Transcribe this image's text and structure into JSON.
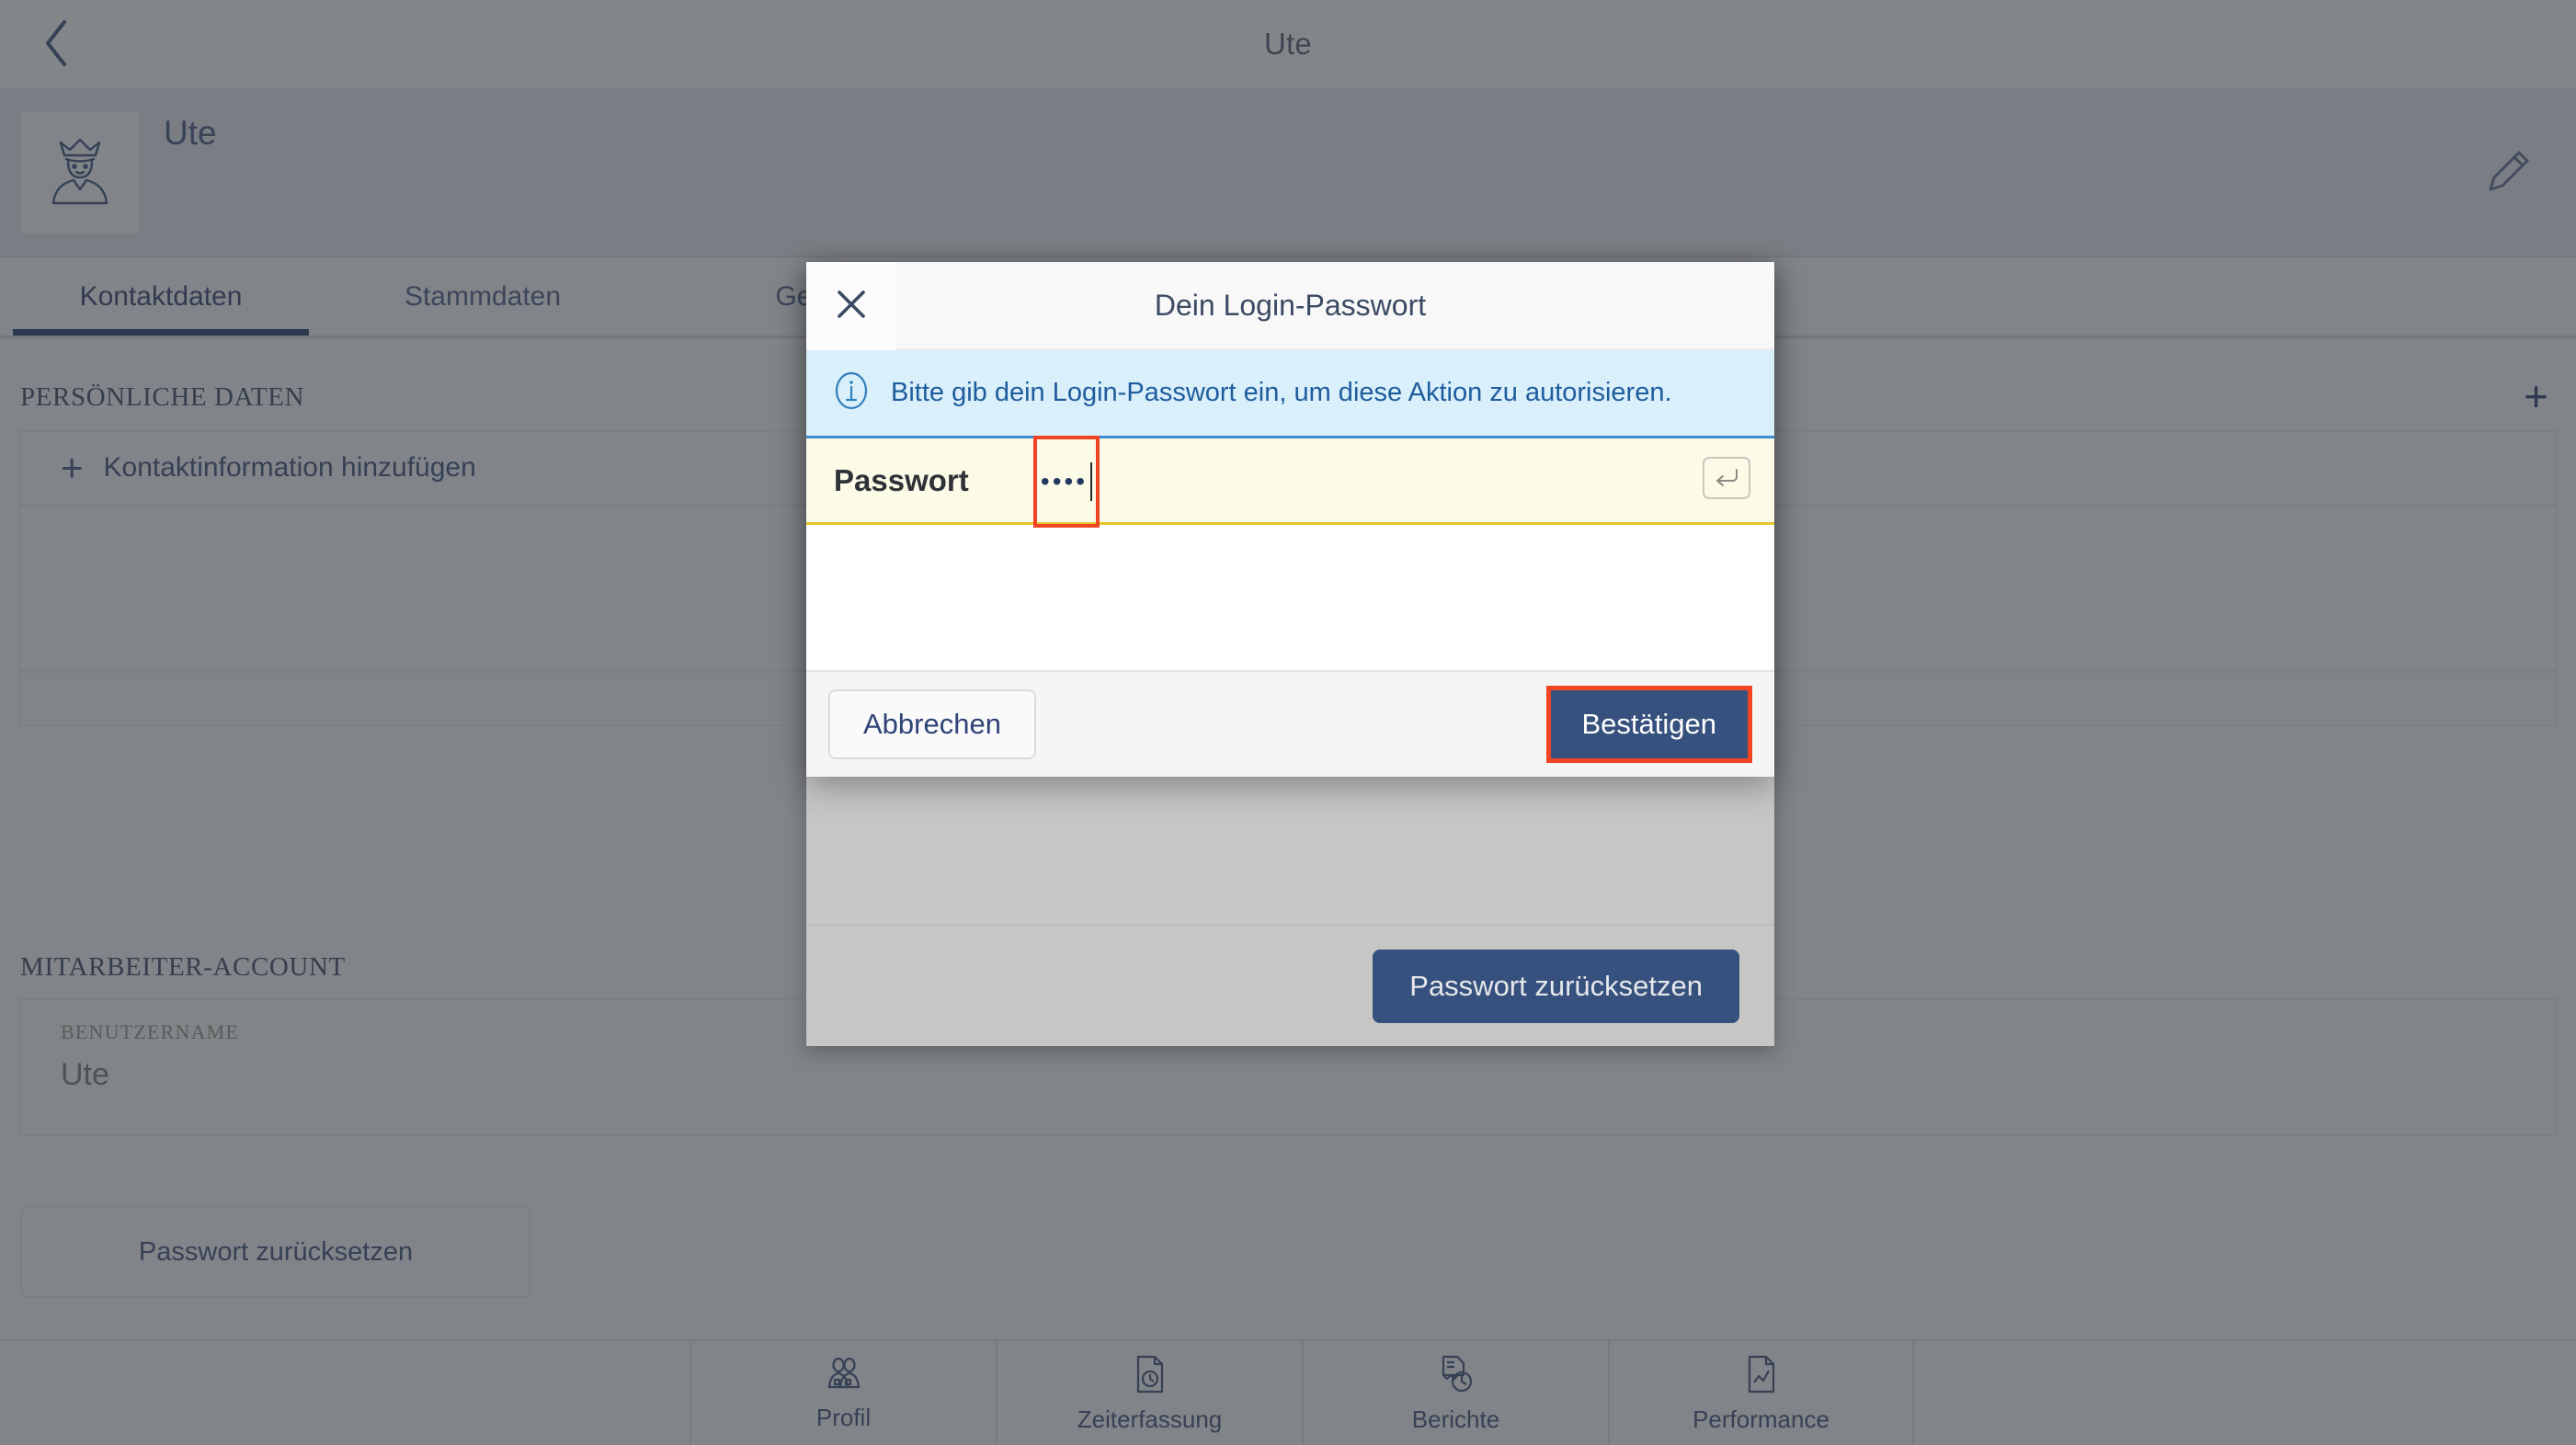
{
  "topbar": {
    "title": "Ute",
    "back_icon": "chevron-left-icon"
  },
  "profile": {
    "name": "Ute",
    "avatar_icon": "king-avatar-icon",
    "edit_icon": "pencil-icon"
  },
  "tabs": [
    {
      "label": "Kontaktdaten",
      "active": true
    },
    {
      "label": "Stammdaten",
      "active": false
    },
    {
      "label": "Geld",
      "active": false
    }
  ],
  "sections": {
    "personal": {
      "title": "PERSÖNLICHE DATEN",
      "add_icon": "plus-icon",
      "add_contact_label": "Kontaktinformation hinzufügen",
      "add_contact_icon": "plus-icon"
    },
    "account": {
      "title": "MITARBEITER-ACCOUNT",
      "username_label": "BENUTZERNAME",
      "username_value": "Ute",
      "reset_password_label": "Passwort zurücksetzen"
    }
  },
  "bottom_nav": [
    {
      "label": "Profil",
      "icon": "people-icon"
    },
    {
      "label": "Zeiterfassung",
      "icon": "document-clock-icon"
    },
    {
      "label": "Berichte",
      "icon": "report-clock-icon"
    },
    {
      "label": "Performance",
      "icon": "document-chart-icon"
    }
  ],
  "under_panel": {
    "reset_password_button": "Passwort zurücksetzen"
  },
  "modal": {
    "title": "Dein Login-Passwort",
    "close_icon": "close-icon",
    "info_icon": "info-icon",
    "info_text": "Bitte gib dein Login-Passwort ein, um diese Aktion zu autorisieren.",
    "password_label": "Passwort",
    "password_masked_value": "••••",
    "password_char_count": "4",
    "enter_key_icon": "enter-return-icon",
    "cancel_label": "Abbrechen",
    "confirm_label": "Bestätigen"
  },
  "colors": {
    "brand_blue": "#37517e",
    "highlight_red": "#f04424",
    "info_blue_bg": "#d9effa",
    "info_blue_text": "#1f5c9e",
    "input_yellow_bg": "#fcfbe8",
    "input_yellow_border": "#e8c531"
  }
}
